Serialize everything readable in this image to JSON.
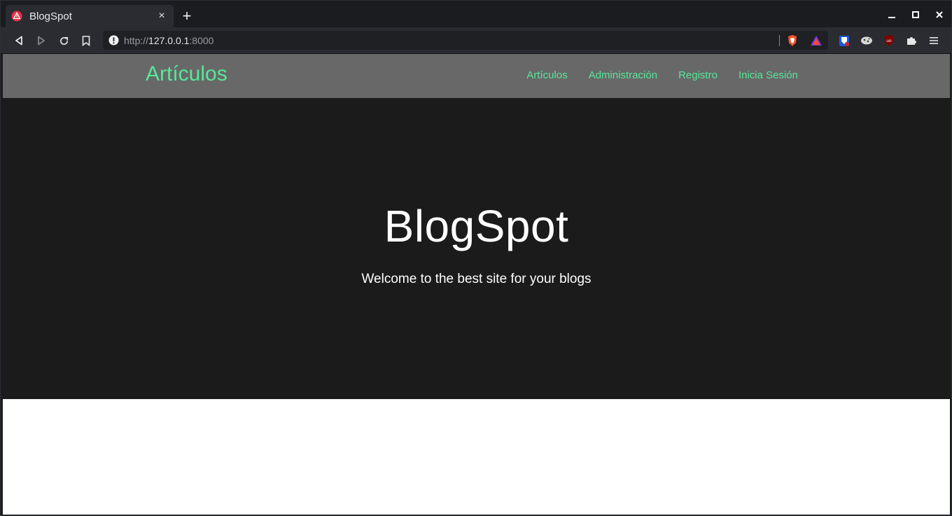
{
  "browser": {
    "tab": {
      "title": "BlogSpot",
      "favicon": "brave-warning-favicon-icon",
      "close": "×"
    },
    "new_tab": "+",
    "window_controls": [
      "minimize-icon",
      "maximize-icon",
      "close-icon"
    ],
    "url": {
      "scheme": "http://",
      "host": "127.0.0.1",
      "port": ":8000"
    },
    "extensions": [
      "brave-shields-icon",
      "brave-rewards-icon",
      "bitwarden-icon",
      "cookie-icon",
      "ublock-icon",
      "puzzle-extensions-icon",
      "menu-icon"
    ]
  },
  "site": {
    "brand": "Artículos",
    "nav": [
      "Artículos",
      "Administración",
      "Registro",
      "Inicia Sesión"
    ],
    "hero": {
      "title": "BlogSpot",
      "subtitle": "Welcome to the best site for your blogs"
    }
  },
  "colors": {
    "accent_green": "#55e89a",
    "navbar_gray": "#686868",
    "hero_dark": "#1b1b1b",
    "browser_chrome": "#1b1c20"
  }
}
